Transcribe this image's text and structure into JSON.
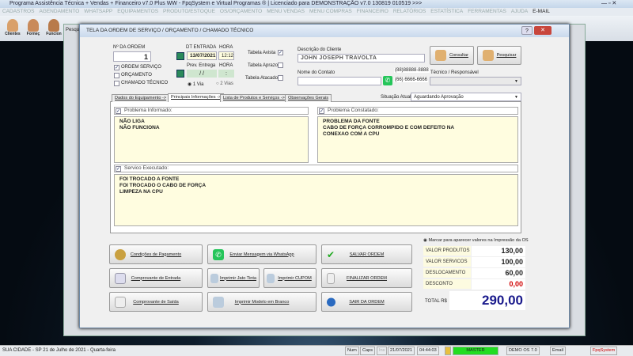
{
  "app": {
    "title": "Programa Assistência Técnica + Vendas + Financeiro v7.0 Plus WW - FpqSystem e Virtual Programas ® | Licenciado para  DEMONSTRAÇÃO v7.0 130819 010519 >>>",
    "menu": [
      "CADASTROS",
      "AGENDAMENTO",
      "WHATSAPP",
      "EQUIPAMENTOS",
      "PRODUTO/ESTOQUE",
      "OS/ORÇAMENTO",
      "MENU VENDAS",
      "MENU COMPRAS",
      "FINANCEIRO",
      "RELATÓRIOS",
      "ESTATÍSTICA",
      "FERRAMENTAS",
      "AJUDA",
      "E-MAIL"
    ],
    "toolbar": [
      "Clientes",
      "Forneç",
      "Funcion"
    ],
    "behind_tab": "Pesqui"
  },
  "dialog": {
    "title": "TELA DA ORDEM DE SERVIÇO / ORÇAMENTO / CHAMADO TÉCNICO",
    "order_label": "Nº DA ORDEM",
    "order_number": "1",
    "types": [
      {
        "label": "ORDEM SERVIÇO",
        "checked": true
      },
      {
        "label": "ORÇAMENTO",
        "checked": false
      },
      {
        "label": "CHAMADO TÉCNICO",
        "checked": false
      }
    ],
    "entry_date_label": "DT ENTRADA",
    "entry_date": "13/07/2021",
    "hour_label": "HORA",
    "entry_hour": "12:12",
    "delivery_label": "Prev. Entrega",
    "delivery_date": "/ /",
    "delivery_hour_label": "HORA",
    "delivery_hour": ":",
    "via1": "1 Via",
    "via2": "2 Vias",
    "tables": [
      {
        "label": "Tabela Avista",
        "checked": true
      },
      {
        "label": "Tabela Aprazo",
        "checked": false
      },
      {
        "label": "Tabela Atacado",
        "checked": false
      }
    ],
    "client_label": "Descrição do Cliente",
    "client": "JOHN JOSEPH TRAVOLTA",
    "contact_label": "Nome do Contato",
    "contact": "",
    "phone1": "(88)88888-8888",
    "phone2": "(66) 6666-6666",
    "consult": "Consultar",
    "search": "Pesquisar",
    "tech_label": "Técnico / Responsável",
    "tech": "",
    "tabs": [
      "Dados do Equipamento ->",
      "Principais Informações ->",
      "Lista de Produtos e Serviços ->",
      "Observações Gerais"
    ],
    "status_label": "Situação Atual:",
    "status": "Aguardando Aprovação",
    "informed_label": "Problema Informado:",
    "informed": "NÃO LIGA\nNÃO FUNCIONA",
    "found_label": "Problema Constatado:",
    "found": "PROBLEMA DA FONTE\nCABO DE FORÇA CORROMPIDO E COM DEFEITO NA\nCONEXAO COM A CPU",
    "done_label": "Servico Executado:",
    "done": "FOI TROCADO A FONTE\nFOI TROCADO O CABO DE FORÇA\nLIMPEZA NA CPU",
    "buttons": {
      "payment": "Condições de Pagamento",
      "whatsapp": "Enviar Mensagem via WhatsApp",
      "save": "SALVAR ORDEM",
      "entry_receipt": "Comprovante de Entrada",
      "inkjet": "Imprimir Jato Tinta",
      "coupon": "Imprimir CUPOM",
      "finish": "FINALIZAR ORDEM",
      "exit_receipt": "Comprovante de Saída",
      "blank": "Imprimir Modelo em Branco",
      "exit": "SAIR DA ORDEM"
    },
    "print_values_label": "Marcar para aparecer valores na Impressão da OS",
    "values": [
      {
        "label": "VALOR PRODUTOS",
        "value": "130,00"
      },
      {
        "label": "VALOR SERVICOS",
        "value": "100,00"
      },
      {
        "label": "DESLOCAMENTO",
        "value": "60,00"
      },
      {
        "label": "DESCONTO",
        "value": "0,00"
      }
    ],
    "total_label": "TOTAL R$",
    "total": "290,00"
  },
  "statusbar": {
    "city": "SUA CIDADE - SP 21 de Julho de 2021 - Quarta-feira",
    "num": "Num",
    "caps": "Caps",
    "ins": "Ins",
    "date": "21/07/2021",
    "time": "04:44:03",
    "user": "MASTER",
    "version": "DEMO OS 7.0",
    "email": "Email",
    "brand": "FpqSystem"
  },
  "colors": {
    "discount": "#d00000",
    "total": "#1a1a8c",
    "user_bg": "#22dd22"
  }
}
